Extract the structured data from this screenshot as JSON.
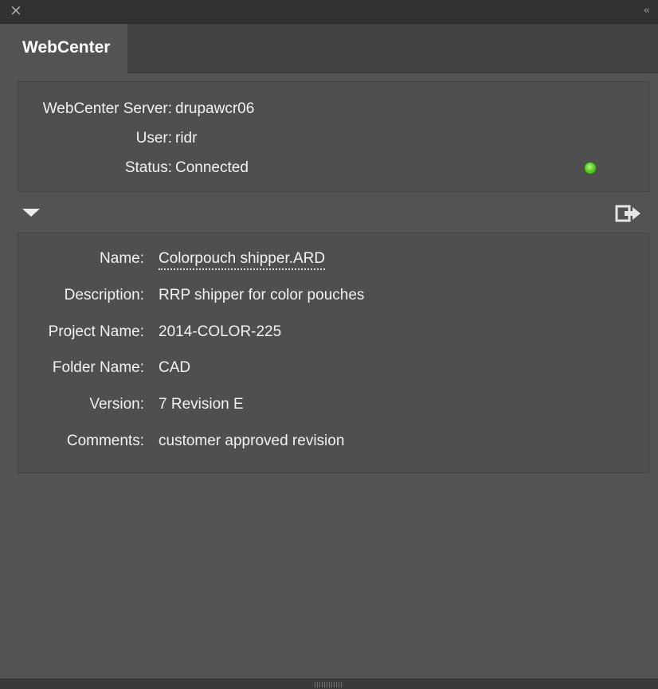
{
  "titlebar": {
    "close_icon": "close-icon",
    "collapse_icon": "double-chevron-left-icon"
  },
  "tabs": [
    {
      "label": "WebCenter",
      "active": true
    }
  ],
  "connection": {
    "server_label": "WebCenter Server:",
    "server_value": "drupawcr06",
    "user_label": "User:",
    "user_value": "ridr",
    "status_label": "Status:",
    "status_value": "Connected",
    "status_indicator_color": "#5fd128"
  },
  "toolbar": {
    "disclosure_icon": "disclosure-triangle-down-icon",
    "logout_icon": "logout-icon"
  },
  "document": {
    "name_label": "Name:",
    "name_value": "Colorpouch shipper.ARD",
    "description_label": "Description:",
    "description_value": "RRP shipper for color pouches",
    "project_label": "Project Name:",
    "project_value": "2014-COLOR-225",
    "folder_label": "Folder Name:",
    "folder_value": "CAD",
    "version_label": "Version:",
    "version_value": "7 Revision E",
    "comments_label": "Comments:",
    "comments_value": "customer approved revision"
  },
  "colors": {
    "panel_bg": "#535353",
    "titlebar_bg": "#323232",
    "tabbar_bg": "#424242",
    "text": "#f2f2f2"
  }
}
